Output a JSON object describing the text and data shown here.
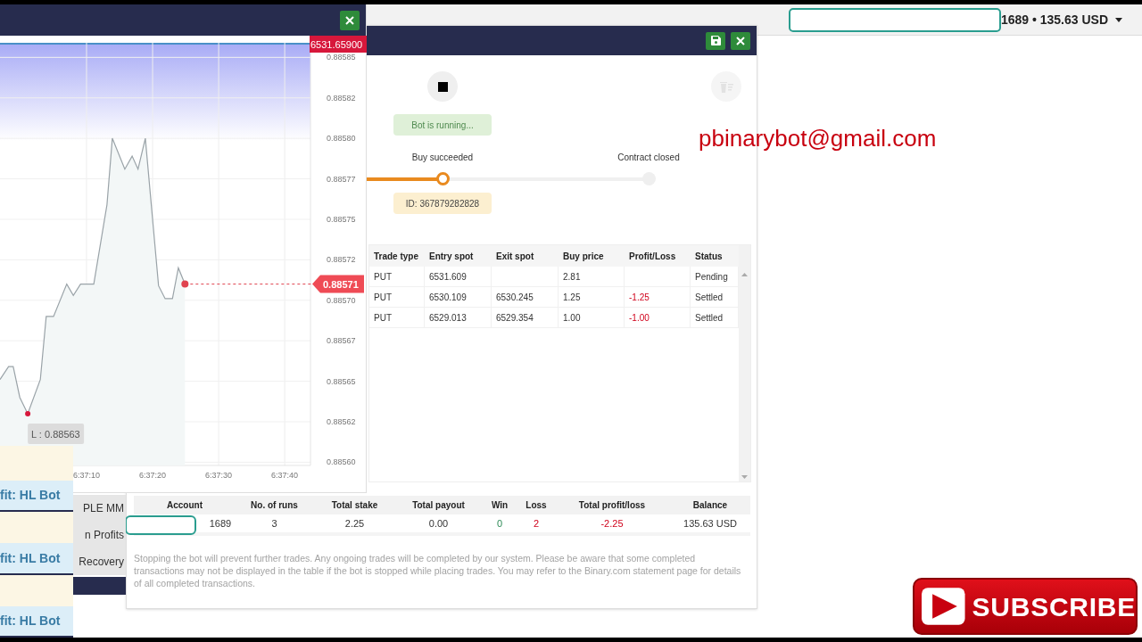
{
  "account_bar": {
    "redacted": true,
    "account": "1689 • 135.63 USD"
  },
  "chart_window": {
    "chart": {
      "chart_data": {
        "type": "line",
        "x": [
          23816.9,
          23818.2,
          23818.9,
          23819.9,
          23821.1,
          23823.0,
          23823.9,
          23825.0,
          23827.0,
          23828.0,
          23829.1,
          23831.1,
          23833.1,
          23833.9,
          23835.8,
          23836.9,
          23837.8,
          23838.9,
          23840.9,
          23841.9,
          23843.0,
          23843.9,
          23844.9
        ],
        "series": [
          {
            "color": "#9aa3a8",
            "values": [
              0.885651,
              0.885659,
              0.885659,
              0.88564,
              0.88563,
              0.885651,
              0.88569,
              0.88569,
              0.88571,
              0.885703,
              0.88571,
              0.88571,
              0.885759,
              0.8858,
              0.885781,
              0.885789,
              0.885781,
              0.8858,
              0.885709,
              0.885701,
              0.885701,
              0.88572,
              0.88571
            ]
          }
        ],
        "xlim": [
          23816.9,
          23863.9
        ],
        "ylim": [
          0.885598,
          0.885859
        ],
        "xticks": [
          {
            "value": 23830,
            "label": "6:37:10"
          },
          {
            "value": 23840,
            "label": "6:37:20"
          },
          {
            "value": 23850,
            "label": "6:37:30"
          },
          {
            "value": 23860,
            "label": "6:37:40"
          }
        ],
        "yticks": [
          {
            "value": 0.88585,
            "label": "0.88585"
          },
          {
            "value": 0.885825,
            "label": "0.88582"
          },
          {
            "value": 0.8858,
            "label": "0.88580"
          },
          {
            "value": 0.885775,
            "label": "0.88577"
          },
          {
            "value": 0.88575,
            "label": "0.88575"
          },
          {
            "value": 0.885725,
            "label": "0.88572"
          },
          {
            "value": 0.8857,
            "label": "0.88570"
          },
          {
            "value": 0.885675,
            "label": "0.88567"
          },
          {
            "value": 0.88565,
            "label": "0.88565"
          },
          {
            "value": 0.885625,
            "label": "0.88562"
          },
          {
            "value": 0.8856,
            "label": "0.88560"
          }
        ],
        "grid": true
      },
      "barrier_tag": "6531.65900",
      "current_price_tag": "0.88571",
      "low_tag": "L : 0.88563"
    }
  },
  "bot_window": {
    "stop_disabled": false,
    "clear_disabled": true,
    "status": "Bot is running...",
    "steps": [
      {
        "label": "Buy succeeded",
        "reached": true
      },
      {
        "label": "Contract closed",
        "reached": false
      }
    ],
    "contract_id": "ID: 367879282828",
    "trades": {
      "columns": [
        "Trade type",
        "Entry spot",
        "Exit spot",
        "Buy price",
        "Profit/Loss",
        "Status"
      ],
      "rows": [
        {
          "trade_type": "PUT",
          "entry_spot": "6531.609",
          "buy_price": "2.81",
          "status": "Pending"
        },
        {
          "trade_type": "PUT",
          "entry_spot": "6530.109",
          "exit_spot": "6530.245",
          "buy_price": "1.25",
          "profit_loss": "-1.25",
          "status": "Settled",
          "loss": true
        },
        {
          "trade_type": "PUT",
          "entry_spot": "6529.013",
          "exit_spot": "6529.354",
          "buy_price": "1.00",
          "profit_loss": "-1.00",
          "status": "Settled",
          "loss": true
        }
      ]
    },
    "summary": {
      "columns": [
        "Account",
        "No. of runs",
        "Total stake",
        "Total payout",
        "Win",
        "Loss",
        "Total profit/loss",
        "Balance"
      ],
      "cells": [
        {
          "text": "1689",
          "positive": false,
          "negative": false,
          "redacted": true
        },
        {
          "text": "3",
          "positive": false,
          "negative": false,
          "redacted": false
        },
        {
          "text": "2.25",
          "positive": false,
          "negative": false,
          "redacted": false
        },
        {
          "text": "0.00",
          "positive": false,
          "negative": false,
          "redacted": false
        },
        {
          "text": "0",
          "positive": true,
          "negative": false,
          "redacted": false
        },
        {
          "text": "2",
          "positive": false,
          "negative": true,
          "redacted": false
        },
        {
          "text": "-2.25",
          "positive": false,
          "negative": true,
          "redacted": false
        },
        {
          "text": "135.63 USD",
          "positive": false,
          "negative": false,
          "redacted": false
        }
      ]
    },
    "disclaimer": "Stopping the bot will prevent further trades. Any ongoing trades will be completed by our system. Please be aware that some completed transactions may not be displayed in the table if the bot is stopped while placing trades. You may refer to the Binary.com statement page for details of all completed transactions."
  },
  "left_panel": {
    "menu_items": [
      "PLE MM",
      "n Profits",
      "Recovery"
    ],
    "cards": [
      {
        "kind": "blank"
      },
      {
        "kind": "label",
        "text": "fit: HL Bot"
      },
      {
        "kind": "blank"
      },
      {
        "kind": "label",
        "text": "fit: HL Bot"
      },
      {
        "kind": "blank"
      },
      {
        "kind": "label",
        "text": "fit: HL Bot"
      }
    ]
  },
  "overlay": {
    "email": "pbinarybot@gmail.com",
    "subscribe": "SUBSCRIBE"
  }
}
